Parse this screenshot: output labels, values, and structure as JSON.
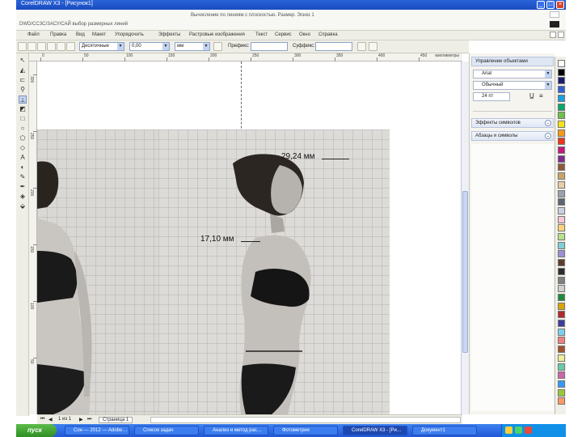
{
  "window": {
    "title": "CorelDRAW X3 - [Рисунок1]",
    "controls": [
      "_",
      "□",
      "×"
    ]
  },
  "info_strip": {
    "center_text": "Вычисление по линиям с плоскостью. Размер. Эскиз 1",
    "left_text": "DWD/ССЗС/ЗАСУ/САЙ  выбор размерных линий",
    "right_icons": [
      "blank",
      "blank"
    ]
  },
  "menubar": {
    "items": [
      "Файл",
      "Правка",
      "Вид",
      "Макет",
      "Упорядочить",
      "Эффекты",
      "Растровые изображения",
      "Текст",
      "Сервис",
      "Окно",
      "Справка"
    ]
  },
  "propbar": {
    "field1": "Десятичные",
    "field2": "0,00",
    "field3": "мм",
    "prefix_label": "Префикс:",
    "prefix_value": "",
    "suffix_label": "Суффикс:",
    "suffix_value": ""
  },
  "ruler": {
    "h_labels": [
      "0",
      "50",
      "100",
      "150",
      "200",
      "250",
      "300",
      "350",
      "400",
      "450"
    ],
    "units": "миллиметры",
    "v_labels": [
      "300",
      "250",
      "200",
      "150",
      "100",
      "50"
    ]
  },
  "measurements": [
    {
      "label": "29,24 мм"
    },
    {
      "label": "17,10 мм"
    }
  ],
  "pagebar": {
    "counter": "1 из 1",
    "page_tab": "Страница 1"
  },
  "docker": {
    "title": "Управление объектами",
    "font_value": "Arial",
    "style_value": "Обычный",
    "size_value": "24 пт",
    "section1": "Эффекты символов",
    "section2": "Абзацы и символы"
  },
  "palette": {
    "colors": [
      "#ffffff",
      "#000000",
      "#1b1b6e",
      "#2f5fd0",
      "#1aa0e0",
      "#00a86b",
      "#6ec04a",
      "#f5e31a",
      "#f39a1a",
      "#e8361b",
      "#c0197a",
      "#7d2b8e",
      "#8c5a3a",
      "#c9a36b",
      "#e6cfa8",
      "#9aa3ae",
      "#5c6570",
      "#c8d0e0",
      "#f7c6d9",
      "#ffd37a",
      "#b7e28a",
      "#7fd1d6",
      "#9b8fd8",
      "#5a3e2b",
      "#2d2d2d",
      "#808080",
      "#d0d0d0",
      "#1f8a3a",
      "#d9a400",
      "#b02a2a",
      "#3c3c9c",
      "#7ad0f0",
      "#f08080",
      "#a0522d",
      "#eeee99",
      "#66ccaa",
      "#cc66aa",
      "#3399ff",
      "#99cc33",
      "#ff9966"
    ]
  },
  "taskbar": {
    "start": "пуск",
    "tasks": [
      "Сон — 2012 — Adobe…",
      "Список задач",
      "Анализ и метод рас…",
      "Фотометрия",
      "CorelDRAW X3 - [Ри…",
      "Документ1"
    ],
    "active_index": 4,
    "clock": ""
  }
}
